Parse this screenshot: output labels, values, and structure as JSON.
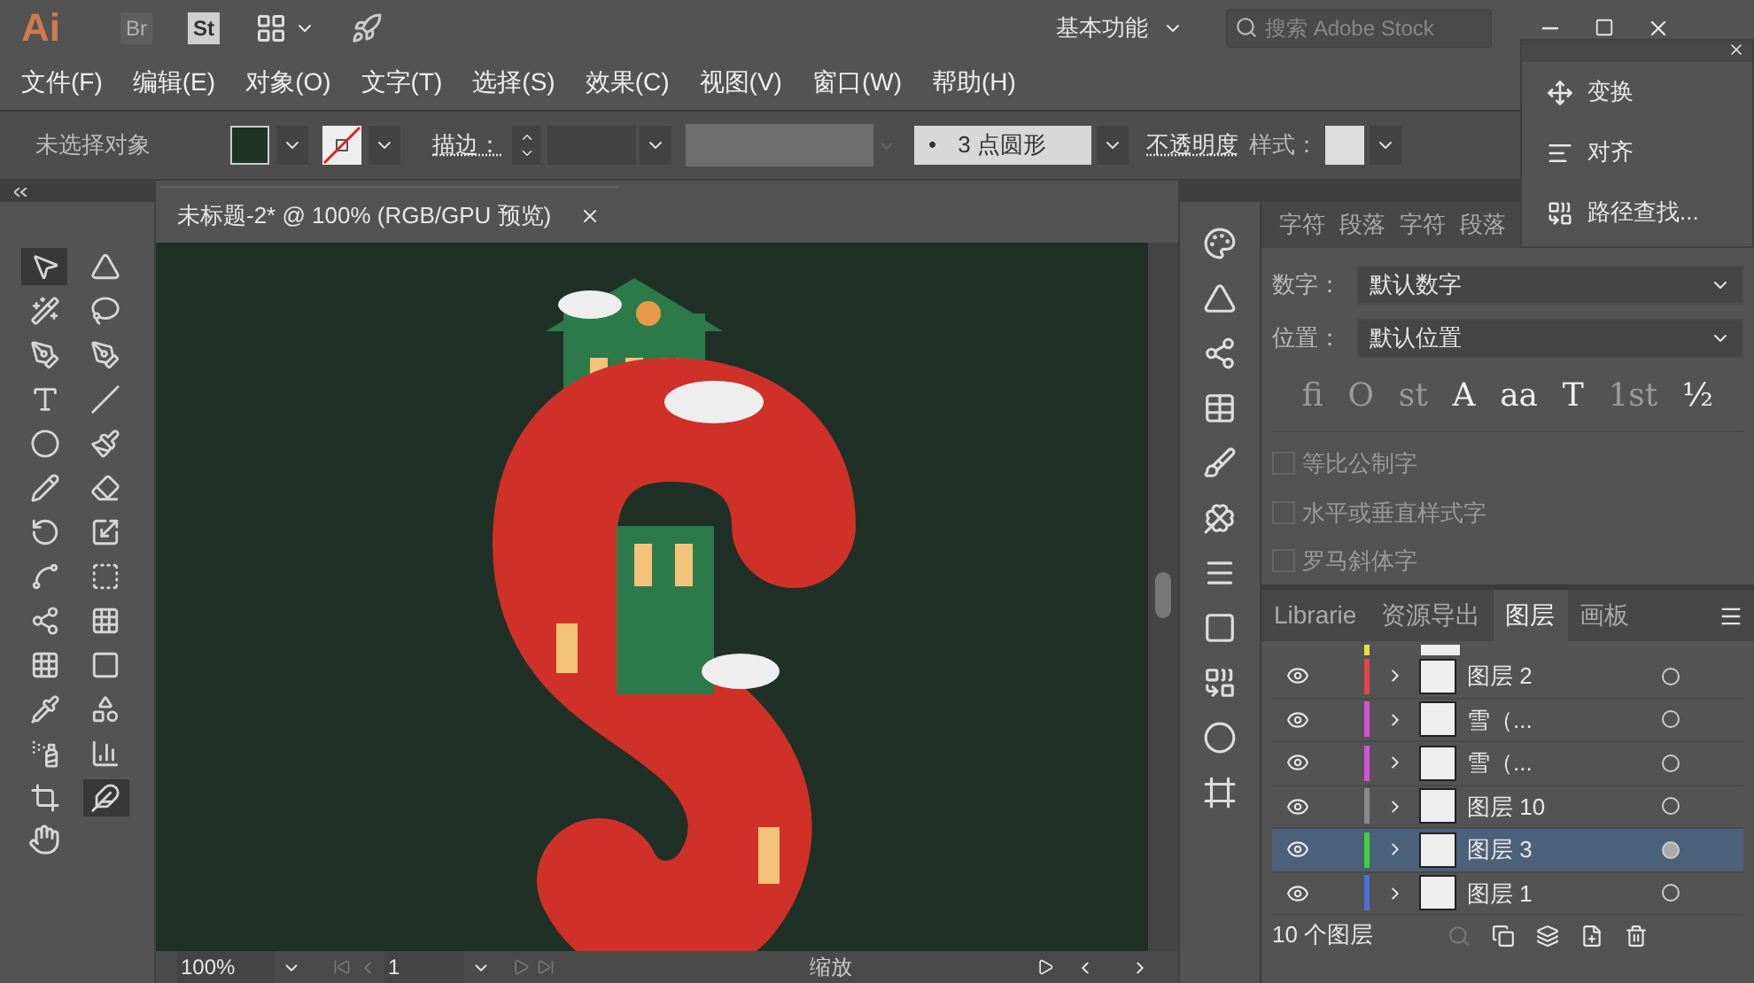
{
  "app_bar": {
    "logo": "Ai",
    "bridge": "Br",
    "stock": "St",
    "workspace": "基本功能",
    "search": {
      "placeholder": "搜索 Adobe Stock"
    }
  },
  "menu": [
    "文件(F)",
    "编辑(E)",
    "对象(O)",
    "文字(T)",
    "选择(S)",
    "效果(C)",
    "视图(V)",
    "窗口(W)",
    "帮助(H)"
  ],
  "control_bar": {
    "selection": "未选择对象",
    "stroke_label": "描边：",
    "brush": "3 点圆形",
    "brush_bullet": "•",
    "opacity": "不透明度",
    "style_label": "样式："
  },
  "floating_panel": {
    "items": [
      "变换",
      "对齐",
      "路径查找..."
    ]
  },
  "document": {
    "tab": "未标题-2* @ 100% (RGB/GPU 预览)",
    "zoom": "100%",
    "artboard": "1",
    "status": "缩放"
  },
  "tools": [
    {
      "selected": true
    },
    {
      "selected": false
    },
    {
      "selected": false
    },
    {
      "selected": false
    },
    {
      "selected": false
    },
    {
      "selected": false
    },
    {
      "selected": false
    },
    {
      "selected": false
    },
    {
      "selected": false
    },
    {
      "selected": false
    },
    {
      "selected": false
    },
    {
      "selected": false
    },
    {
      "selected": false
    },
    {
      "selected": false
    },
    {
      "selected": false
    },
    {
      "selected": false
    },
    {
      "selected": false
    },
    {
      "selected": false
    },
    {
      "selected": false
    },
    {
      "selected": false
    },
    {
      "selected": false
    },
    {
      "selected": false
    },
    {
      "selected": false
    },
    {
      "selected": false
    },
    {
      "selected": false
    },
    {
      "selected": true
    }
  ],
  "character_panel": {
    "tabs": [
      "字符",
      "段落",
      "字符",
      "段落"
    ],
    "fields": [
      {
        "label": "数字：",
        "value": "默认数字"
      },
      {
        "label": "位置：",
        "value": "默认位置"
      }
    ],
    "glyphs": [
      {
        "label": "fi",
        "disabled": true
      },
      {
        "label": "O",
        "disabled": true
      },
      {
        "label": "st",
        "disabled": true
      },
      {
        "label": "A",
        "disabled": false
      },
      {
        "label": "aa",
        "disabled": false
      },
      {
        "label": "T",
        "disabled": false
      },
      {
        "label": "1st",
        "disabled": true
      },
      {
        "label": "½",
        "disabled": false
      }
    ],
    "options": [
      {
        "label": "等比公制字",
        "checked": false,
        "disabled": true
      },
      {
        "label": "水平或垂直样式字",
        "checked": false,
        "disabled": true
      },
      {
        "label": "罗马斜体字",
        "checked": false,
        "disabled": true
      }
    ]
  },
  "layers_panel": {
    "tabs": [
      {
        "label": "Librarie",
        "selected": false
      },
      {
        "label": "资源导出",
        "selected": false
      },
      {
        "label": "图层",
        "selected": true
      },
      {
        "label": "画板",
        "selected": false
      }
    ],
    "partial_row": {
      "color": "#e8e03a"
    },
    "layers": [
      {
        "name": "图层 2",
        "color": "#e04646",
        "selected": false
      },
      {
        "name": "雪（...",
        "color": "#d94fd9",
        "selected": false
      },
      {
        "name": "雪（...",
        "color": "#d94fd9",
        "selected": false
      },
      {
        "name": "图层 10",
        "color": "#8a8a8a",
        "selected": false
      },
      {
        "name": "图层 3",
        "color": "#3ed13e",
        "selected": true
      },
      {
        "name": "图层 1",
        "color": "#4a6fe0",
        "selected": false
      }
    ],
    "count": "10 个图层"
  }
}
